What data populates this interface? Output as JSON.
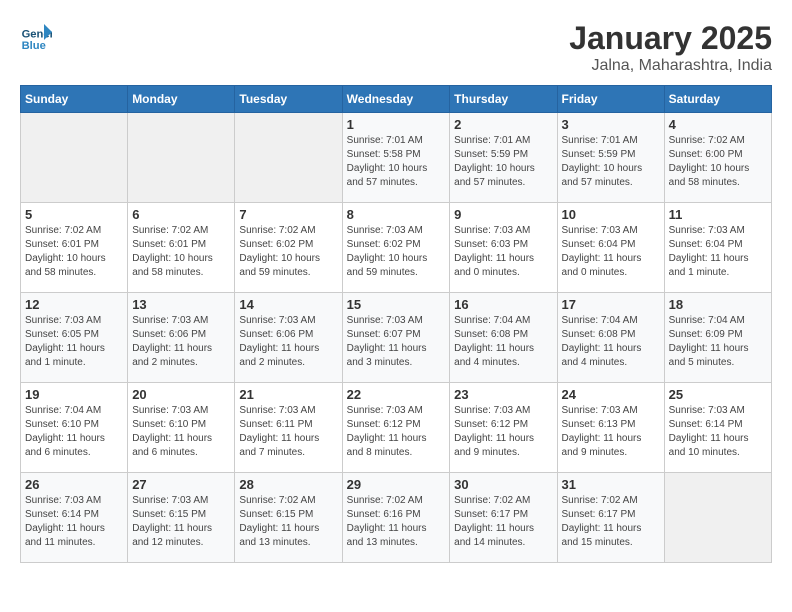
{
  "logo": {
    "name_line1": "General",
    "name_line2": "Blue"
  },
  "title": "January 2025",
  "subtitle": "Jalna, Maharashtra, India",
  "weekdays": [
    "Sunday",
    "Monday",
    "Tuesday",
    "Wednesday",
    "Thursday",
    "Friday",
    "Saturday"
  ],
  "days": {
    "1": {
      "sunrise": "7:01 AM",
      "sunset": "5:58 PM",
      "daylight": "10 hours and 57 minutes."
    },
    "2": {
      "sunrise": "7:01 AM",
      "sunset": "5:59 PM",
      "daylight": "10 hours and 57 minutes."
    },
    "3": {
      "sunrise": "7:01 AM",
      "sunset": "5:59 PM",
      "daylight": "10 hours and 57 minutes."
    },
    "4": {
      "sunrise": "7:02 AM",
      "sunset": "6:00 PM",
      "daylight": "10 hours and 58 minutes."
    },
    "5": {
      "sunrise": "7:02 AM",
      "sunset": "6:01 PM",
      "daylight": "10 hours and 58 minutes."
    },
    "6": {
      "sunrise": "7:02 AM",
      "sunset": "6:01 PM",
      "daylight": "10 hours and 58 minutes."
    },
    "7": {
      "sunrise": "7:02 AM",
      "sunset": "6:02 PM",
      "daylight": "10 hours and 59 minutes."
    },
    "8": {
      "sunrise": "7:03 AM",
      "sunset": "6:02 PM",
      "daylight": "10 hours and 59 minutes."
    },
    "9": {
      "sunrise": "7:03 AM",
      "sunset": "6:03 PM",
      "daylight": "11 hours and 0 minutes."
    },
    "10": {
      "sunrise": "7:03 AM",
      "sunset": "6:04 PM",
      "daylight": "11 hours and 0 minutes."
    },
    "11": {
      "sunrise": "7:03 AM",
      "sunset": "6:04 PM",
      "daylight": "11 hours and 1 minute."
    },
    "12": {
      "sunrise": "7:03 AM",
      "sunset": "6:05 PM",
      "daylight": "11 hours and 1 minute."
    },
    "13": {
      "sunrise": "7:03 AM",
      "sunset": "6:06 PM",
      "daylight": "11 hours and 2 minutes."
    },
    "14": {
      "sunrise": "7:03 AM",
      "sunset": "6:06 PM",
      "daylight": "11 hours and 2 minutes."
    },
    "15": {
      "sunrise": "7:03 AM",
      "sunset": "6:07 PM",
      "daylight": "11 hours and 3 minutes."
    },
    "16": {
      "sunrise": "7:04 AM",
      "sunset": "6:08 PM",
      "daylight": "11 hours and 4 minutes."
    },
    "17": {
      "sunrise": "7:04 AM",
      "sunset": "6:08 PM",
      "daylight": "11 hours and 4 minutes."
    },
    "18": {
      "sunrise": "7:04 AM",
      "sunset": "6:09 PM",
      "daylight": "11 hours and 5 minutes."
    },
    "19": {
      "sunrise": "7:04 AM",
      "sunset": "6:10 PM",
      "daylight": "11 hours and 6 minutes."
    },
    "20": {
      "sunrise": "7:03 AM",
      "sunset": "6:10 PM",
      "daylight": "11 hours and 6 minutes."
    },
    "21": {
      "sunrise": "7:03 AM",
      "sunset": "6:11 PM",
      "daylight": "11 hours and 7 minutes."
    },
    "22": {
      "sunrise": "7:03 AM",
      "sunset": "6:12 PM",
      "daylight": "11 hours and 8 minutes."
    },
    "23": {
      "sunrise": "7:03 AM",
      "sunset": "6:12 PM",
      "daylight": "11 hours and 9 minutes."
    },
    "24": {
      "sunrise": "7:03 AM",
      "sunset": "6:13 PM",
      "daylight": "11 hours and 9 minutes."
    },
    "25": {
      "sunrise": "7:03 AM",
      "sunset": "6:14 PM",
      "daylight": "11 hours and 10 minutes."
    },
    "26": {
      "sunrise": "7:03 AM",
      "sunset": "6:14 PM",
      "daylight": "11 hours and 11 minutes."
    },
    "27": {
      "sunrise": "7:03 AM",
      "sunset": "6:15 PM",
      "daylight": "11 hours and 12 minutes."
    },
    "28": {
      "sunrise": "7:02 AM",
      "sunset": "6:15 PM",
      "daylight": "11 hours and 13 minutes."
    },
    "29": {
      "sunrise": "7:02 AM",
      "sunset": "6:16 PM",
      "daylight": "11 hours and 13 minutes."
    },
    "30": {
      "sunrise": "7:02 AM",
      "sunset": "6:17 PM",
      "daylight": "11 hours and 14 minutes."
    },
    "31": {
      "sunrise": "7:02 AM",
      "sunset": "6:17 PM",
      "daylight": "11 hours and 15 minutes."
    }
  },
  "labels": {
    "sunrise": "Sunrise:",
    "sunset": "Sunset:",
    "daylight": "Daylight:"
  }
}
